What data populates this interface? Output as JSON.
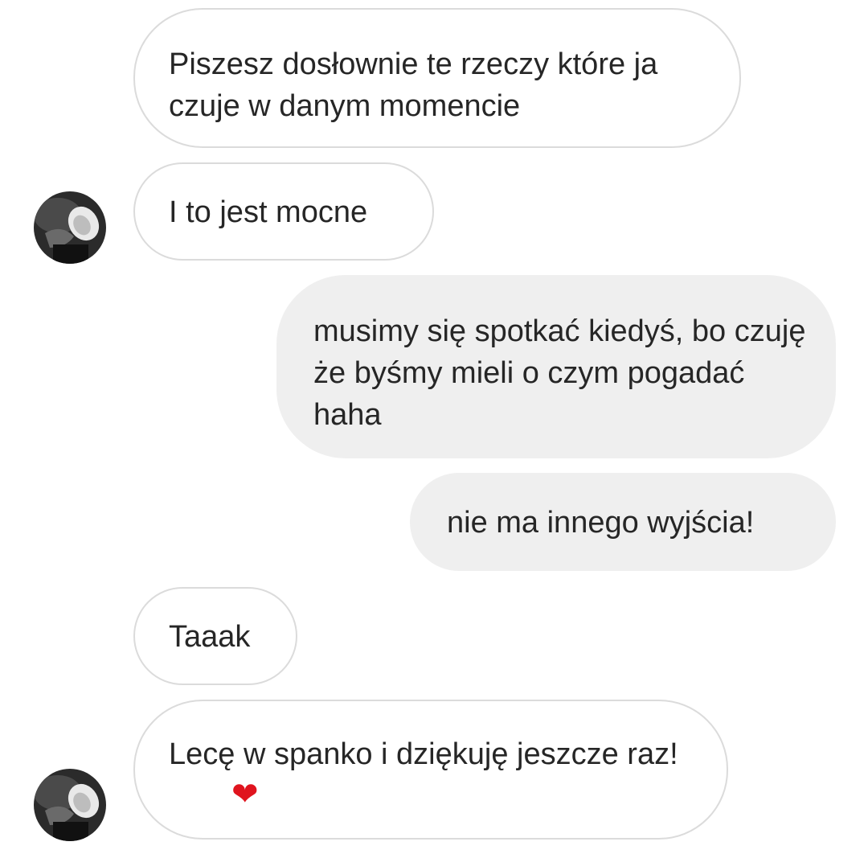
{
  "conversation": {
    "messages": [
      {
        "direction": "incoming",
        "text": "Piszesz dosłownie te rzeczy które ja czuje w danym momencie"
      },
      {
        "direction": "incoming",
        "text": "I to jest mocne",
        "avatar": "contact-avatar"
      },
      {
        "direction": "outgoing",
        "text": "musimy się spotkać kiedyś, bo czuję że byśmy mieli o czym pogadać haha"
      },
      {
        "direction": "outgoing",
        "text": "nie ma innego wyjścia!"
      },
      {
        "direction": "incoming",
        "text": "Taaak"
      },
      {
        "direction": "incoming",
        "text": "Lecę w spanko i dziękuję jeszcze raz!",
        "emoji": "❤",
        "emoji_icon": "red-heart-icon",
        "avatar": "contact-avatar"
      }
    ]
  },
  "colors": {
    "incoming_bubble_bg": "#ffffff",
    "incoming_bubble_border": "#dbdbdb",
    "outgoing_bubble_bg": "#efefef",
    "text": "#262626",
    "heart": "#e0141e"
  }
}
